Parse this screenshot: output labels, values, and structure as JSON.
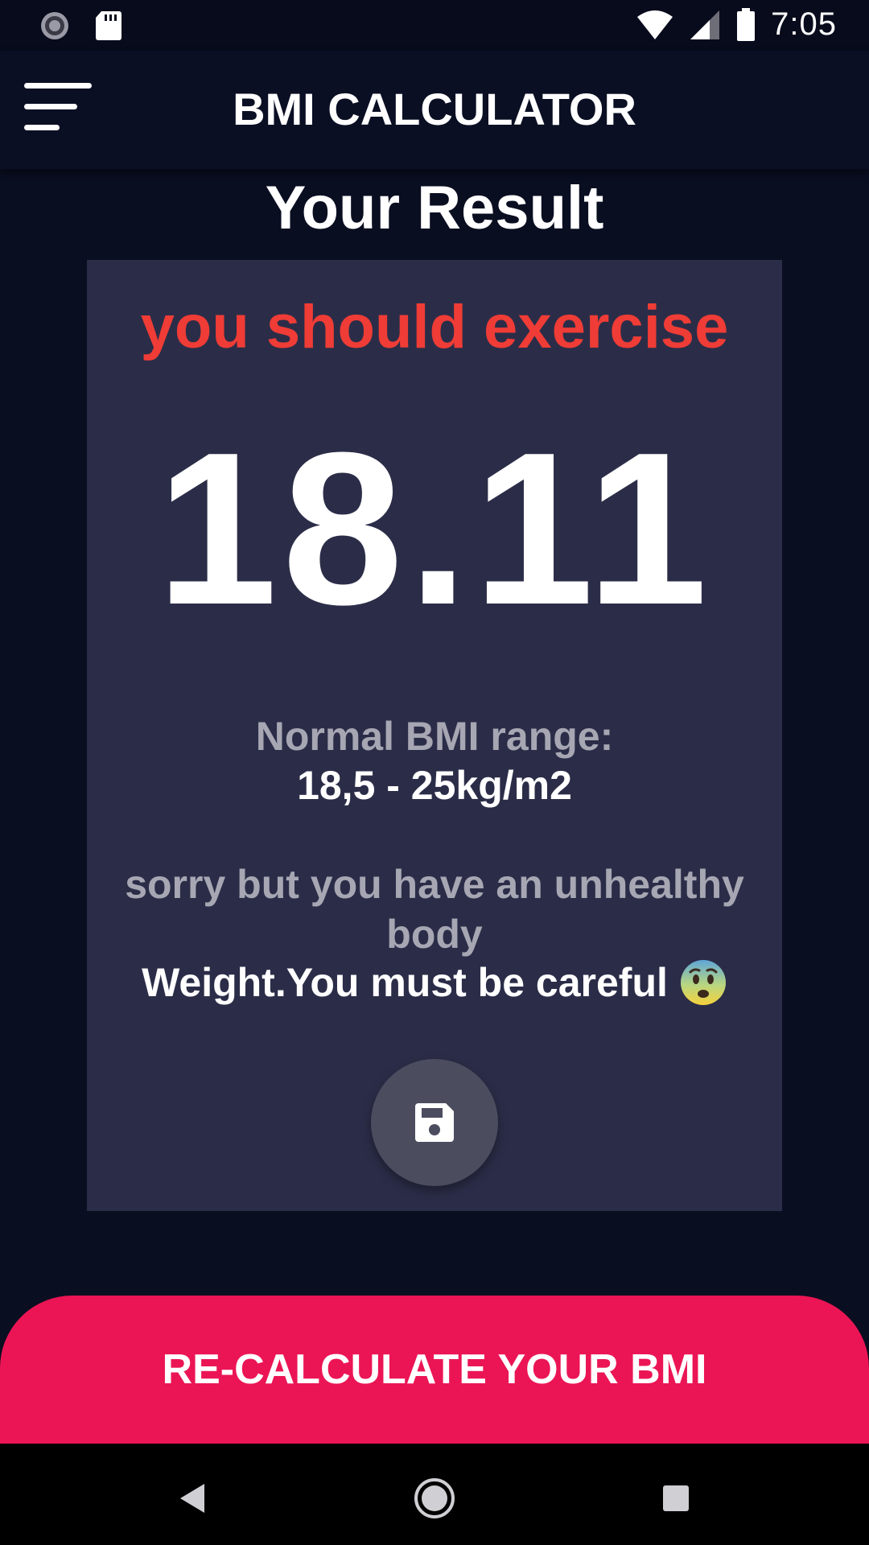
{
  "status_bar": {
    "time": "7:05",
    "icons": [
      "loading-spinner-icon",
      "sd-card-icon",
      "wifi-icon",
      "signal-icon",
      "battery-icon"
    ]
  },
  "app_bar": {
    "title": "BMI CALCULATOR",
    "menu_icon": "menu-icon"
  },
  "result": {
    "heading": "Your Result",
    "status": "you should exercise",
    "status_color": "#ef3c36",
    "bmi": "18.11",
    "range_label": "Normal BMI range:",
    "range_value": "18,5 - 25kg/m2",
    "advice": "sorry but you have an unhealthy body",
    "advice_strong": "Weight.You must be careful",
    "emoji_icon": "anxious-face-icon",
    "save_icon": "save-icon"
  },
  "actions": {
    "recalculate_label": "RE-CALCULATE YOUR BMI",
    "accent_color": "#eb1555"
  },
  "nav_bar": {
    "icons": [
      "back-icon",
      "home-icon",
      "recents-icon"
    ]
  }
}
